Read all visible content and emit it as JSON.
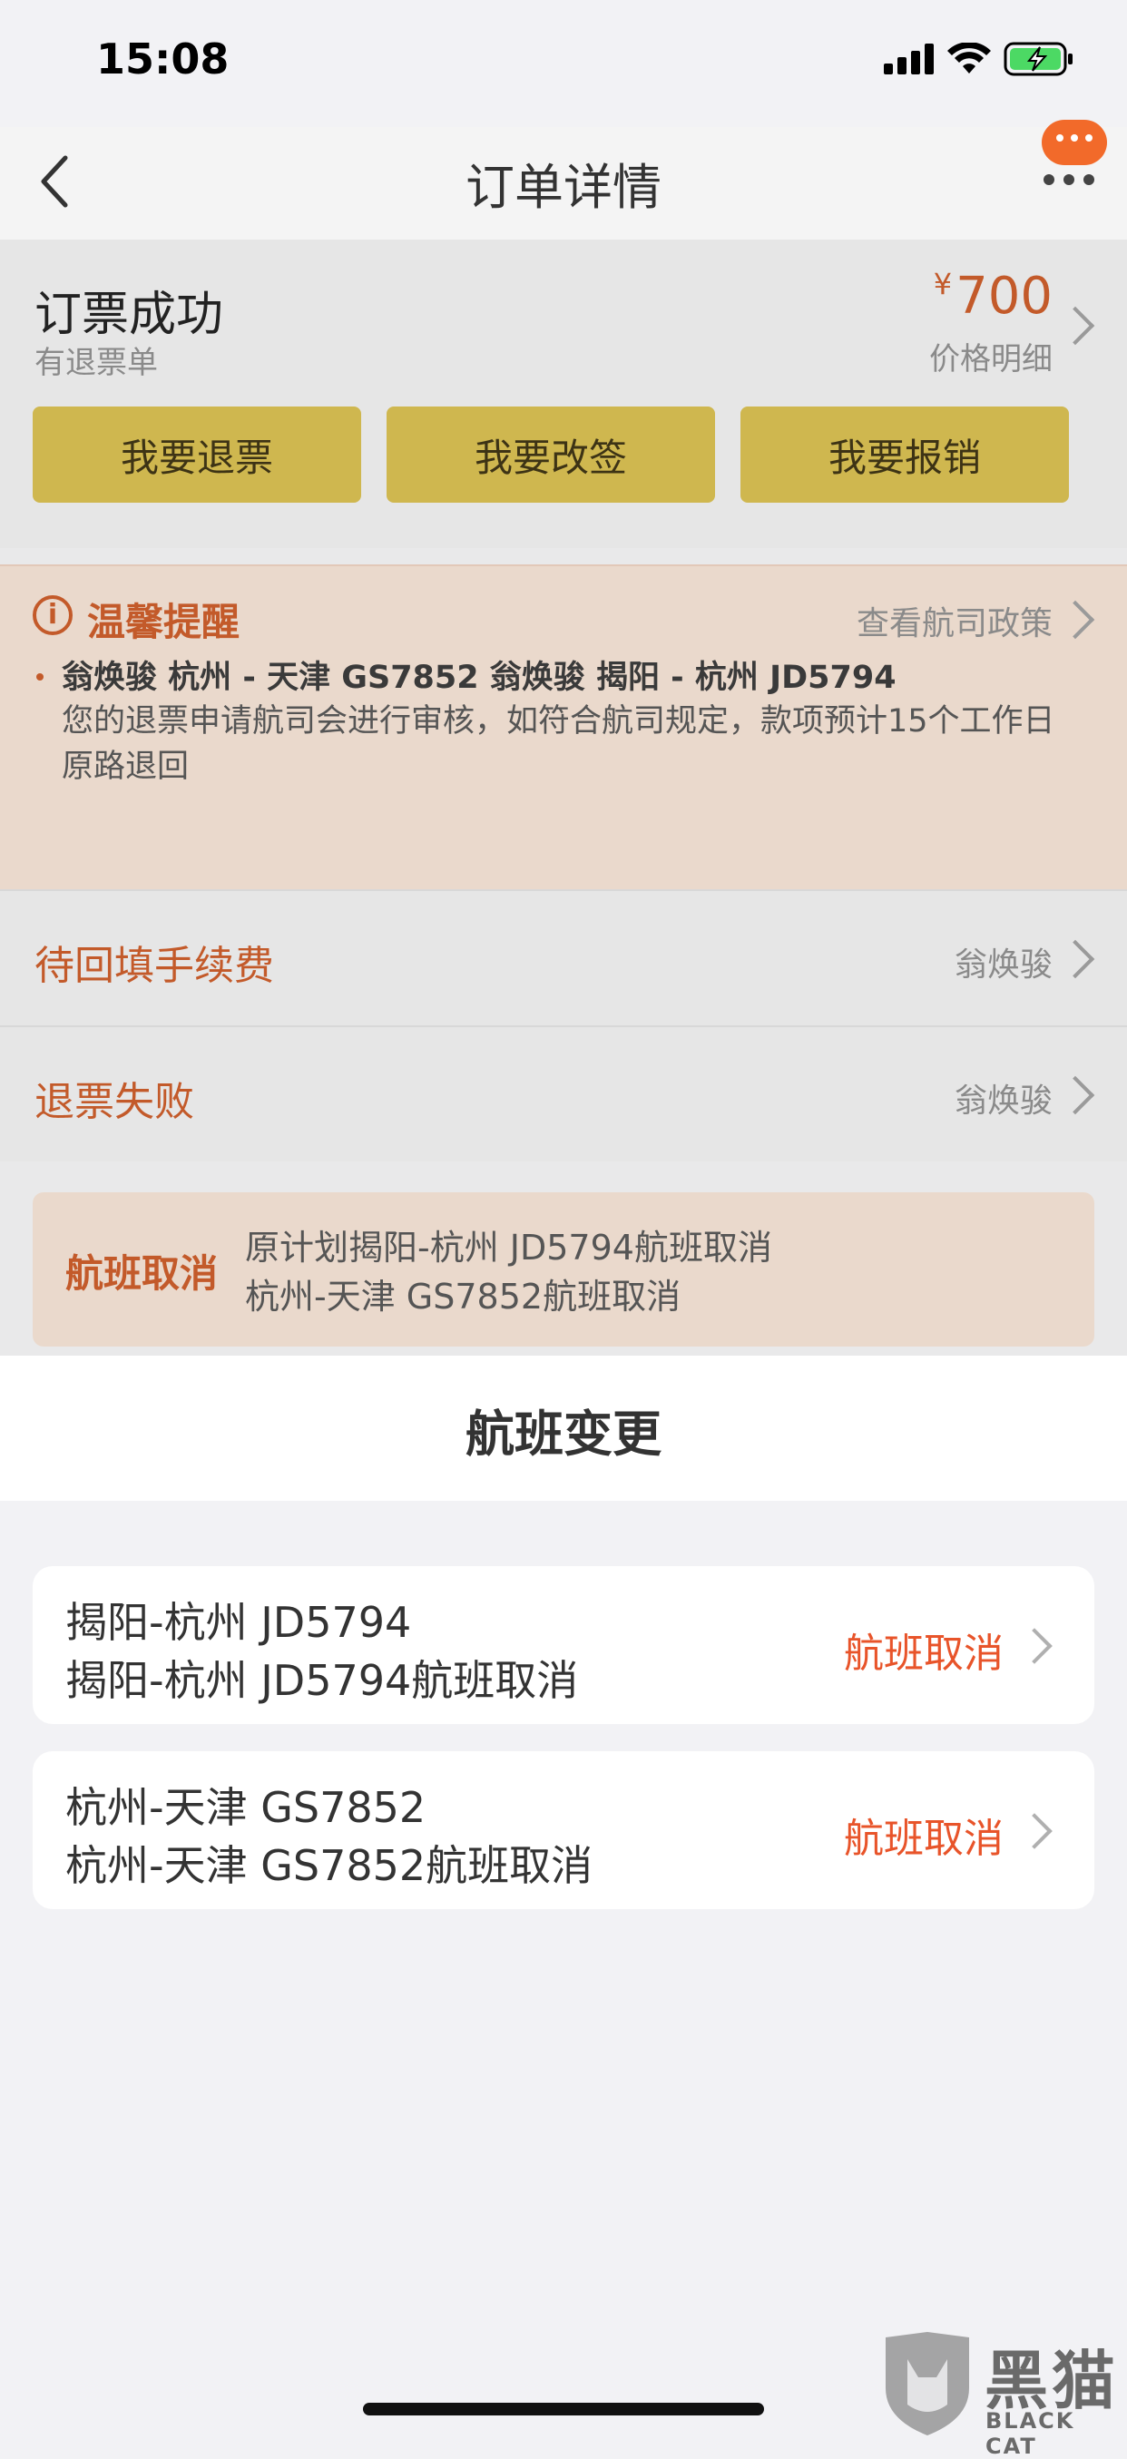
{
  "status_bar": {
    "time": "15:08"
  },
  "nav": {
    "title": "订单详情"
  },
  "order": {
    "status": "订票成功",
    "sub_status": "有退票单",
    "currency": "¥",
    "price": "700",
    "price_detail": "价格明细",
    "buttons": [
      "我要退票",
      "我要改签",
      "我要报销"
    ]
  },
  "notice": {
    "icon": "i",
    "title": "温馨提醒",
    "link": "查看航司政策",
    "route": "翁焕骏 杭州 - 天津 GS7852 翁焕骏 揭阳 - 杭州 JD5794",
    "text": "您的退票申请航司会进行审核，如符合航司规定，款项预计15个工作日原路退回"
  },
  "rows": [
    {
      "label": "待回填手续费",
      "right": "翁焕骏"
    },
    {
      "label": "退票失败",
      "right": "翁焕骏"
    }
  ],
  "cancel_banner": {
    "tag": "航班取消",
    "line1": "原计划揭阳-杭州 JD5794航班取消",
    "line2": "杭州-天津 GS7852航班取消"
  },
  "sheet": {
    "title": "航班变更",
    "flights": [
      {
        "line1": "揭阳-杭州 JD5794",
        "line2": "揭阳-杭州 JD5794航班取消",
        "status": "航班取消"
      },
      {
        "line1": "杭州-天津 GS7852",
        "line2": "杭州-天津 GS7852航班取消",
        "status": "航班取消"
      }
    ]
  },
  "watermark": {
    "text": "黑猫",
    "sub": "BLACK CAT"
  },
  "colors": {
    "accent": "#e8542a",
    "button": "#cfb74f",
    "more_badge": "#f26a2a"
  }
}
